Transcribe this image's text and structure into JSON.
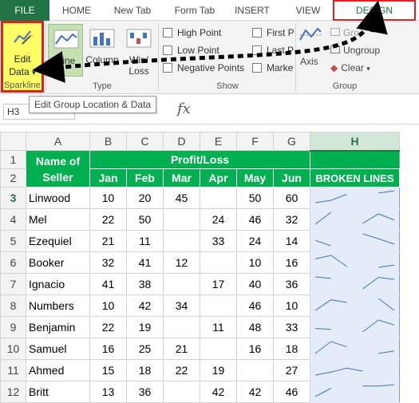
{
  "tabs": [
    {
      "label": "FILE"
    },
    {
      "label": "HOME"
    },
    {
      "label": "New Tab"
    },
    {
      "label": "Form Tab"
    },
    {
      "label": "INSERT"
    },
    {
      "label": "VIEW"
    },
    {
      "label": "DESIGN"
    }
  ],
  "ribbon": {
    "sparkline_group": {
      "edit_line1": "Edit",
      "edit_line2": "Data",
      "caret": "▾",
      "label": "Sparkline"
    },
    "type_group": {
      "line": "Line",
      "column": "Column",
      "winloss_line1": "Win/",
      "winloss_line2": "Loss",
      "label": "Type"
    },
    "show_group": {
      "high_point": "High Point",
      "low_point": "Low Point",
      "negative_points": "Negative Points",
      "first_point": "First P",
      "last_point": "Last P",
      "markers": "Marke",
      "label": "Show"
    },
    "style_group": {
      "axis": "Axis",
      "group": "Gro",
      "ungroup": "Ungroup",
      "clear": "Clear",
      "clear_caret": "▾",
      "label": "Group"
    }
  },
  "tooltip": "Edit Group Location & Data",
  "formula_bar": {
    "name_box": "H3",
    "cancel": "✕",
    "enter": "✓",
    "fx": "fx"
  },
  "grid": {
    "columns": [
      "A",
      "B",
      "C",
      "D",
      "E",
      "F",
      "G",
      "H"
    ],
    "rows": [
      "1",
      "2",
      "3",
      "4",
      "5",
      "6",
      "7",
      "8",
      "9",
      "10",
      "11",
      "12"
    ],
    "header": {
      "name_line1": "Name of",
      "name_line2": "Seller",
      "profit_loss": "Profit/Loss",
      "months": [
        "Jan",
        "Feb",
        "Mar",
        "Apr",
        "May",
        "Jun"
      ],
      "broken_lines": "BROKEN LINES"
    },
    "data": [
      {
        "name": "Linwood",
        "values": [
          "10",
          "20",
          "45",
          "",
          "50",
          "60"
        ]
      },
      {
        "name": "Mel",
        "values": [
          "22",
          "50",
          "",
          "24",
          "46",
          "32"
        ]
      },
      {
        "name": "Ezequiel",
        "values": [
          "21",
          "11",
          "",
          "33",
          "24",
          "14"
        ]
      },
      {
        "name": "Booker",
        "values": [
          "32",
          "41",
          "12",
          "",
          "10",
          "16"
        ]
      },
      {
        "name": "Ignacio",
        "values": [
          "41",
          "38",
          "",
          "17",
          "40",
          "36"
        ]
      },
      {
        "name": "Numbers",
        "values": [
          "10",
          "42",
          "34",
          "",
          "46",
          "10"
        ]
      },
      {
        "name": "Benjamin",
        "values": [
          "22",
          "19",
          "",
          "11",
          "48",
          "33"
        ]
      },
      {
        "name": "Samuel",
        "values": [
          "16",
          "25",
          "21",
          "",
          "16",
          "18"
        ]
      },
      {
        "name": "Ahmed",
        "values": [
          "15",
          "18",
          "22",
          "19",
          "",
          "27"
        ]
      },
      {
        "name": "Britt",
        "values": [
          "13",
          "36",
          "",
          "42",
          "42",
          "46"
        ]
      }
    ]
  },
  "colors": {
    "excel_green": "#217346",
    "header_green": "#00b050",
    "highlight_red": "#e02020",
    "highlight_yellow": "#ffff66",
    "sparkline_blue": "#4472c4"
  }
}
